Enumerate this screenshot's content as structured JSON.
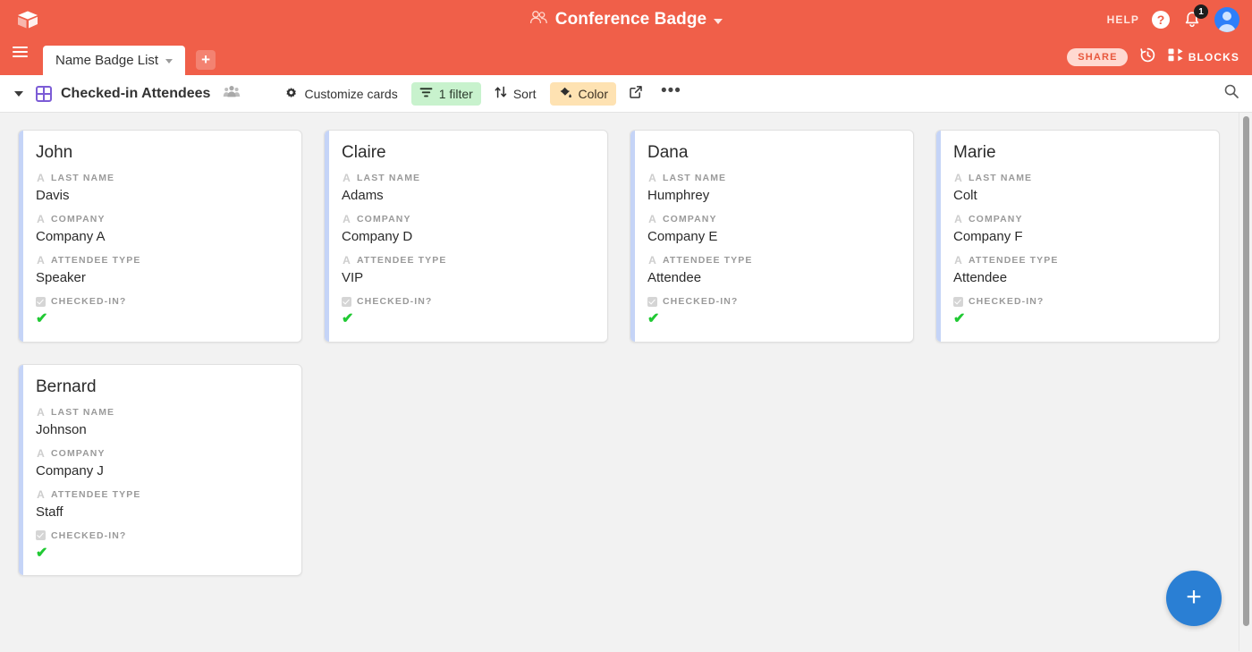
{
  "topbar": {
    "logo_icon": "airtable-cube-icon",
    "app_title": "Conference Badge",
    "app_title_icon": "people-group-icon",
    "app_title_caret": "chevron-down-icon",
    "help_label": "HELP",
    "help_icon": "question-mark-icon",
    "notifications_icon": "bell-icon",
    "notifications_count": "1",
    "avatar_icon": "user-avatar-icon",
    "bg_color": "#f05f49"
  },
  "tabbar": {
    "menu_icon": "hamburger-menu-icon",
    "active_tab": "Name Badge List",
    "tab_caret": "chevron-down-icon",
    "add_table_icon": "plus-icon",
    "share_label": "SHARE",
    "history_icon": "history-clock-icon",
    "blocks_label": "BLOCKS",
    "blocks_icon": "blocks-grid-icon"
  },
  "viewbar": {
    "collapse_icon": "chevron-down-icon",
    "view_type_icon": "gallery-grid-icon",
    "view_name": "Checked-in Attendees",
    "collaborators_icon": "collaborators-icon",
    "tools": {
      "customize": {
        "label": "Customize cards",
        "icon": "gear-icon"
      },
      "filter": {
        "label": "1 filter",
        "icon": "filter-icon",
        "bg": "#c8f2cd"
      },
      "sort": {
        "label": "Sort",
        "icon": "sort-arrows-icon"
      },
      "color": {
        "label": "Color",
        "icon": "paint-bucket-icon",
        "bg": "#fee2b2"
      },
      "share_view_icon": "share-view-icon",
      "more_icon": "ellipsis-icon"
    },
    "search_icon": "search-icon"
  },
  "gallery": {
    "field_labels": {
      "last_name": "LAST NAME",
      "company": "COMPANY",
      "attendee_type": "ATTENDEE TYPE",
      "checked_in": "CHECKED-IN?"
    },
    "field_type_icons": {
      "text": "text-field-icon",
      "checkbox": "checkbox-field-icon"
    },
    "checked_mark": "✔",
    "accent_color": "#c5d4f7",
    "cards": [
      {
        "title": "John",
        "last_name": "Davis",
        "company": "Company A",
        "attendee_type": "Speaker",
        "checked_in": true
      },
      {
        "title": "Claire",
        "last_name": "Adams",
        "company": "Company D",
        "attendee_type": "VIP",
        "checked_in": true
      },
      {
        "title": "Dana",
        "last_name": "Humphrey",
        "company": "Company E",
        "attendee_type": "Attendee",
        "checked_in": true
      },
      {
        "title": "Marie",
        "last_name": "Colt",
        "company": "Company F",
        "attendee_type": "Attendee",
        "checked_in": true
      },
      {
        "title": "Bernard",
        "last_name": "Johnson",
        "company": "Company J",
        "attendee_type": "Staff",
        "checked_in": true
      }
    ]
  },
  "fab": {
    "icon": "plus-icon",
    "color": "#2a7fd4"
  }
}
